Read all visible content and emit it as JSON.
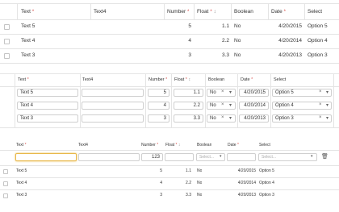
{
  "columns": {
    "text": "Text",
    "text4": "Text4",
    "number": "Number",
    "float": "Float",
    "boolean": "Boolean",
    "date": "Date",
    "select": "Select",
    "required_mark": "*",
    "sort_mark": "↕"
  },
  "rows": [
    {
      "text": "Text 5",
      "text4": "",
      "number": "5",
      "float": "1.1",
      "boolean": "No",
      "date": "4/20/2015",
      "select": "Option 5"
    },
    {
      "text": "Text 4",
      "text4": "",
      "number": "4",
      "float": "2.2",
      "boolean": "No",
      "date": "4/20/2014",
      "select": "Option 4"
    },
    {
      "text": "Text 3",
      "text4": "",
      "number": "3",
      "float": "3.3",
      "boolean": "No",
      "date": "4/20/2013",
      "select": "Option 3"
    }
  ],
  "new_row": {
    "text_value": "",
    "number_value": "123",
    "boolean_placeholder": "Select...",
    "select_placeholder": "Select..."
  },
  "icons": {
    "clear": "×",
    "dropdown": "▾",
    "delete": "🗑"
  },
  "colors": {
    "required": "#d9534f",
    "focus_border": "#e8b84a",
    "grid_line": "#e4e4e4"
  }
}
